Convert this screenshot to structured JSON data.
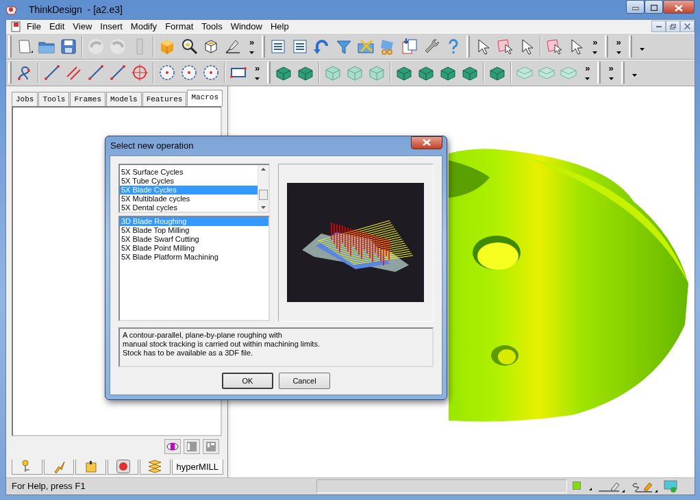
{
  "window": {
    "title": "ThinkDesign  - [a2.e3]"
  },
  "menu": [
    {
      "label": "File"
    },
    {
      "label": "Edit"
    },
    {
      "label": "View"
    },
    {
      "label": "Insert"
    },
    {
      "label": "Modify"
    },
    {
      "label": "Format"
    },
    {
      "label": "Tools"
    },
    {
      "label": "Window"
    },
    {
      "label": "Help"
    }
  ],
  "toolbar_rows": [
    {
      "chevrons": [
        "»",
        "»",
        "»"
      ]
    },
    {
      "chevrons": [
        "»",
        "»",
        "»"
      ]
    }
  ],
  "left_panel": {
    "tabs": [
      {
        "label": "Jobs",
        "selected": false
      },
      {
        "label": "Tools",
        "selected": false
      },
      {
        "label": "Frames",
        "selected": false
      },
      {
        "label": "Models",
        "selected": false
      },
      {
        "label": "Features",
        "selected": false
      },
      {
        "label": "Macros",
        "selected": true
      }
    ],
    "bottom_tabs": [
      {
        "kind": "icon",
        "selected": false
      },
      {
        "kind": "icon",
        "selected": false
      },
      {
        "kind": "icon",
        "selected": false
      },
      {
        "kind": "icon",
        "selected": false
      },
      {
        "kind": "icon",
        "selected": false
      },
      {
        "kind": "text",
        "label": "hyperMILL",
        "selected": true
      }
    ]
  },
  "dialog": {
    "title": "Select new operation",
    "categories": [
      {
        "label": "5X Surface Cycles",
        "selected": false
      },
      {
        "label": "5X Tube Cycles",
        "selected": false
      },
      {
        "label": "5X Blade Cycles",
        "selected": true
      },
      {
        "label": "5X Multiblade cycles",
        "selected": false
      },
      {
        "label": "5X Dental cycles",
        "selected": false
      }
    ],
    "operations": [
      {
        "label": "3D Blade Roughing",
        "selected": true
      },
      {
        "label": "5X Blade Top Milling",
        "selected": false
      },
      {
        "label": "5X Blade Swarf Cutting",
        "selected": false
      },
      {
        "label": "5X Blade Point Milling",
        "selected": false
      },
      {
        "label": "5X Blade Platform Machining",
        "selected": false
      }
    ],
    "description": [
      "A contour-parallel, plane-by-plane roughing with",
      "manual stock tracking is carried out within machining limits.",
      "Stock has to be available as a 3DF file."
    ],
    "buttons": [
      {
        "label": "OK",
        "default": true
      },
      {
        "label": "Cancel",
        "default": false
      }
    ]
  },
  "status_bar": {
    "text": "For Help, press F1"
  }
}
